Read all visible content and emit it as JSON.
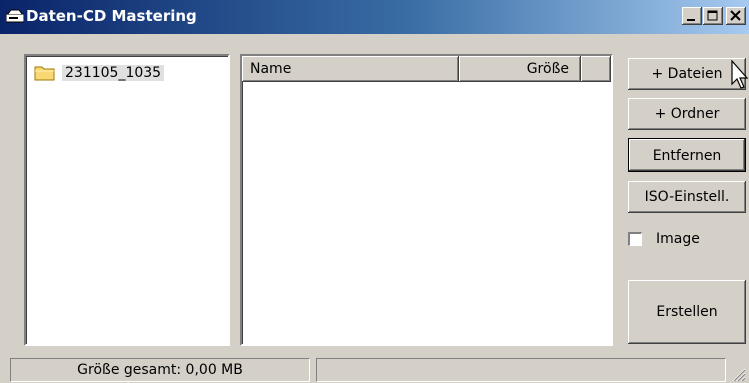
{
  "window": {
    "title": "Daten-CD Mastering",
    "title_icon": "cd-drive-icon",
    "controls": [
      "minimize",
      "maximize",
      "close"
    ]
  },
  "tree": {
    "items": [
      {
        "label": "231105_1035",
        "icon": "folder-icon"
      }
    ]
  },
  "file_list": {
    "columns": [
      "Name",
      "Größe"
    ],
    "rows": []
  },
  "buttons": {
    "add_files": "+ Dateien",
    "add_folder": "+ Ordner",
    "remove": "Entfernen",
    "iso_settings": "ISO-Einstell.",
    "create": "Erstellen"
  },
  "image_checkbox": {
    "label": "Image",
    "checked": false
  },
  "status": {
    "total_size": "Größe gesamt: 0,00 MB",
    "secondary": ""
  },
  "colors": {
    "title_gradient_start": "#0a246a",
    "title_gradient_end": "#a6caf0",
    "face": "#d4d0c8",
    "folder": "#f8d775"
  }
}
